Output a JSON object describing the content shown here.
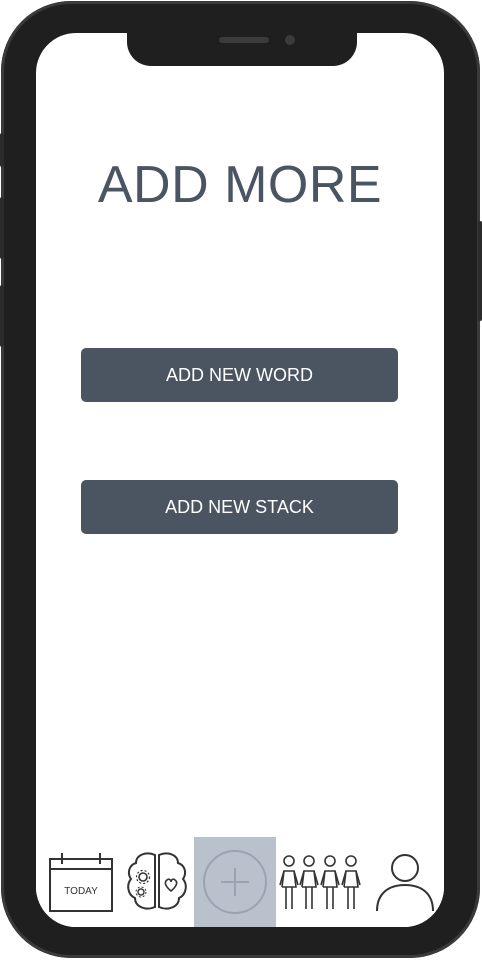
{
  "screen": {
    "title": "ADD MORE"
  },
  "actions": {
    "add_word_label": "ADD NEW WORD",
    "add_stack_label": "ADD NEW STACK"
  },
  "tabbar": {
    "items": [
      {
        "icon": "calendar-icon",
        "label": "TODAY",
        "active": false
      },
      {
        "icon": "brain-icon",
        "active": false
      },
      {
        "icon": "plus-circle-icon",
        "active": true
      },
      {
        "icon": "people-group-icon",
        "active": false
      },
      {
        "icon": "profile-icon",
        "active": false
      }
    ]
  },
  "colors": {
    "title": "#4a5462",
    "button": "#4b5561",
    "active_tab": "#b8c1cc",
    "phone_frame": "#1f1f1f"
  }
}
